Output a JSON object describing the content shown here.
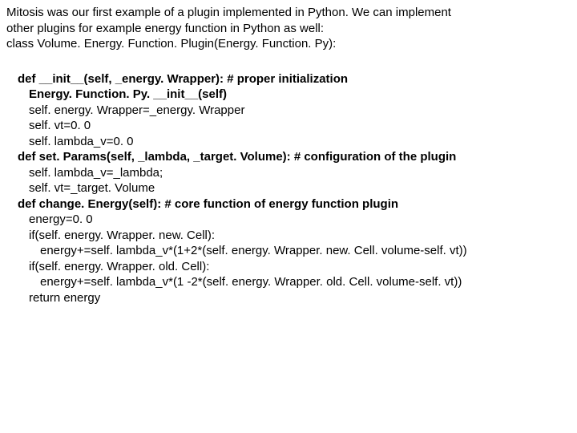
{
  "intro": {
    "line1": "Mitosis was our first example of a plugin implemented in Python. We can implement",
    "line2": "other plugins for example energy function in Python as well:",
    "line3": "class Volume. Energy. Function. Plugin(Energy. Function. Py):"
  },
  "code": {
    "l1": "def __init__(self, _energy. Wrapper): # proper initialization",
    "l2": "Energy. Function. Py. __init__(self)",
    "l3": "self. energy. Wrapper=_energy. Wrapper",
    "l4": "self. vt=0. 0",
    "l5": "self. lambda_v=0. 0",
    "l6": "def set. Params(self, _lambda, _target. Volume): # configuration of the plugin",
    "l7": "self. lambda_v=_lambda;",
    "l8": "self. vt=_target. Volume",
    "l9": "def change. Energy(self): # core function of energy function plugin",
    "l10": "energy=0. 0",
    "l11": "if(self. energy. Wrapper. new. Cell):",
    "l12": "energy+=self. lambda_v*(1+2*(self. energy. Wrapper. new. Cell. volume-self. vt))",
    "l13": "if(self. energy. Wrapper. old. Cell):",
    "l14": "energy+=self. lambda_v*(1 -2*(self. energy. Wrapper. old. Cell. volume-self. vt))",
    "l15": "return energy"
  }
}
